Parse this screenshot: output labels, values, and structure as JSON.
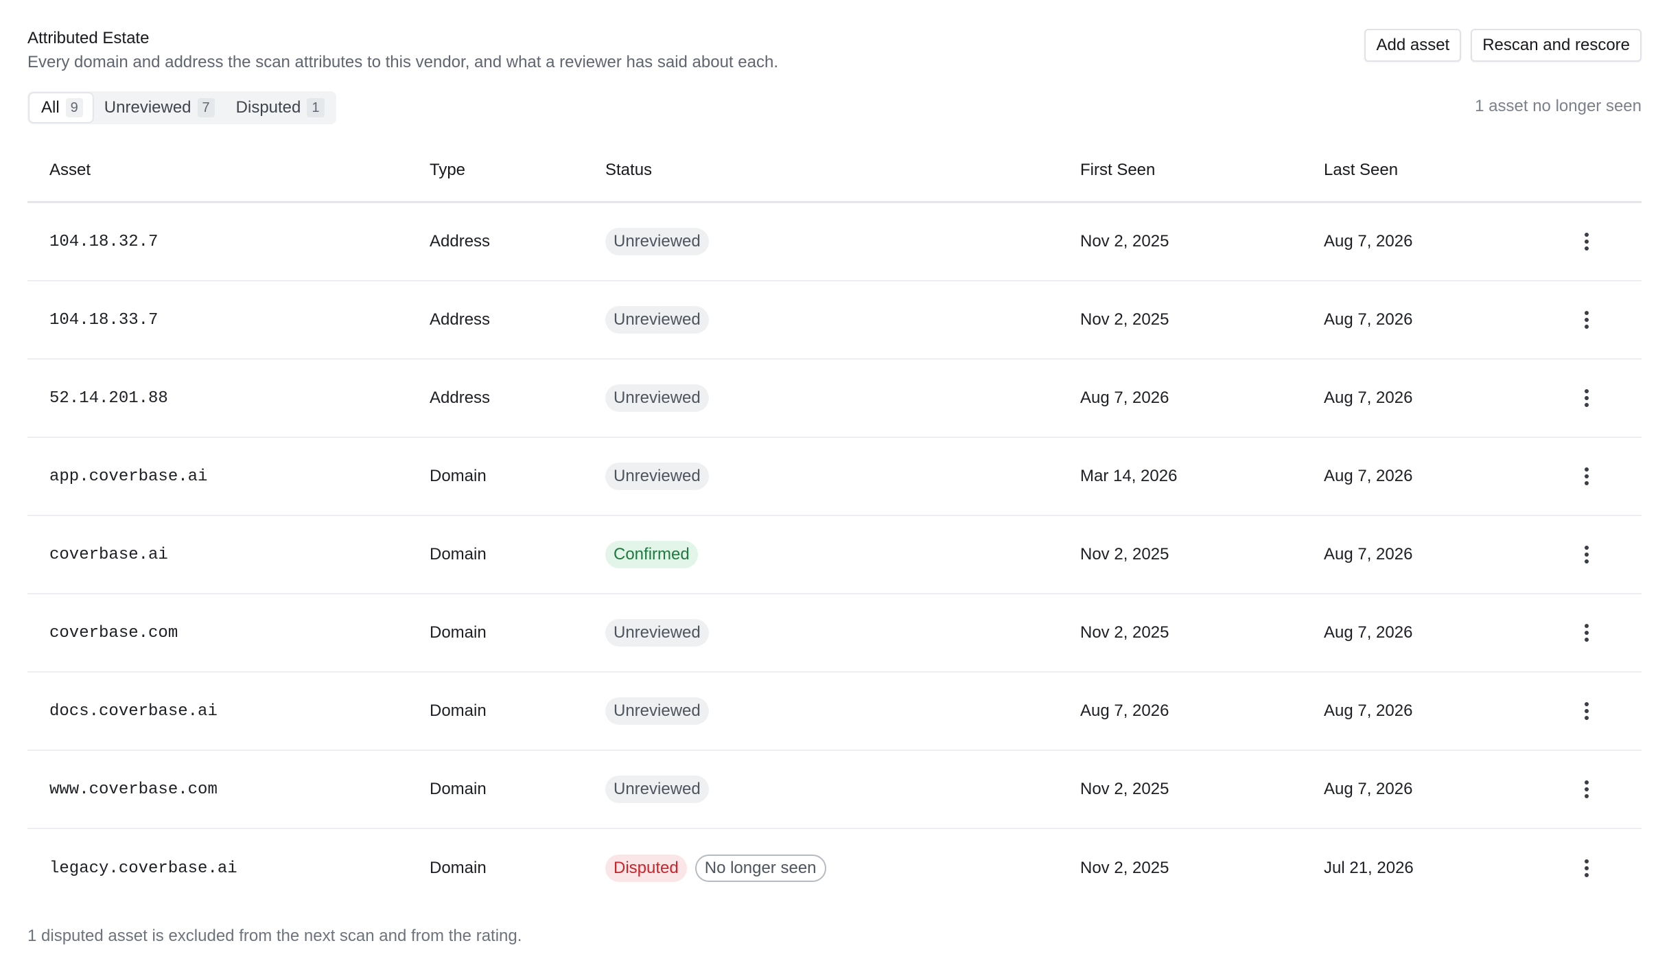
{
  "header": {
    "title": "Attributed Estate",
    "subtitle": "Every domain and address the scan attributes to this vendor, and what a reviewer has said about each.",
    "add_asset_label": "Add asset",
    "rescan_label": "Rescan and rescore"
  },
  "tabs": [
    {
      "label": "All",
      "count": "9",
      "active": true
    },
    {
      "label": "Unreviewed",
      "count": "7",
      "active": false
    },
    {
      "label": "Disputed",
      "count": "1",
      "active": false
    }
  ],
  "no_longer_seen_note": "1 asset no longer seen",
  "table": {
    "columns": {
      "asset": "Asset",
      "type": "Type",
      "status": "Status",
      "first_seen": "First Seen",
      "last_seen": "Last Seen"
    },
    "rows": [
      {
        "asset": "104.18.32.7",
        "type": "Address",
        "status": "Unreviewed",
        "status_kind": "unreviewed",
        "extra_badge": "",
        "first_seen": "Nov 2, 2025",
        "last_seen": "Aug 7, 2026"
      },
      {
        "asset": "104.18.33.7",
        "type": "Address",
        "status": "Unreviewed",
        "status_kind": "unreviewed",
        "extra_badge": "",
        "first_seen": "Nov 2, 2025",
        "last_seen": "Aug 7, 2026"
      },
      {
        "asset": "52.14.201.88",
        "type": "Address",
        "status": "Unreviewed",
        "status_kind": "unreviewed",
        "extra_badge": "",
        "first_seen": "Aug 7, 2026",
        "last_seen": "Aug 7, 2026"
      },
      {
        "asset": "app.coverbase.ai",
        "type": "Domain",
        "status": "Unreviewed",
        "status_kind": "unreviewed",
        "extra_badge": "",
        "first_seen": "Mar 14, 2026",
        "last_seen": "Aug 7, 2026"
      },
      {
        "asset": "coverbase.ai",
        "type": "Domain",
        "status": "Confirmed",
        "status_kind": "confirmed",
        "extra_badge": "",
        "first_seen": "Nov 2, 2025",
        "last_seen": "Aug 7, 2026"
      },
      {
        "asset": "coverbase.com",
        "type": "Domain",
        "status": "Unreviewed",
        "status_kind": "unreviewed",
        "extra_badge": "",
        "first_seen": "Nov 2, 2025",
        "last_seen": "Aug 7, 2026"
      },
      {
        "asset": "docs.coverbase.ai",
        "type": "Domain",
        "status": "Unreviewed",
        "status_kind": "unreviewed",
        "extra_badge": "",
        "first_seen": "Aug 7, 2026",
        "last_seen": "Aug 7, 2026"
      },
      {
        "asset": "www.coverbase.com",
        "type": "Domain",
        "status": "Unreviewed",
        "status_kind": "unreviewed",
        "extra_badge": "",
        "first_seen": "Nov 2, 2025",
        "last_seen": "Aug 7, 2026"
      },
      {
        "asset": "legacy.coverbase.ai",
        "type": "Domain",
        "status": "Disputed",
        "status_kind": "disputed",
        "extra_badge": "No longer seen",
        "first_seen": "Nov 2, 2025",
        "last_seen": "Jul 21, 2026"
      }
    ],
    "row_menu_icon": "more-vertical-icon"
  },
  "footer_note": "1 disputed asset is excluded from the next scan and from the rating.",
  "colors": {
    "confirmed": "#1e7a3f",
    "disputed": "#c8252c",
    "unreviewed": "#4e555e"
  }
}
